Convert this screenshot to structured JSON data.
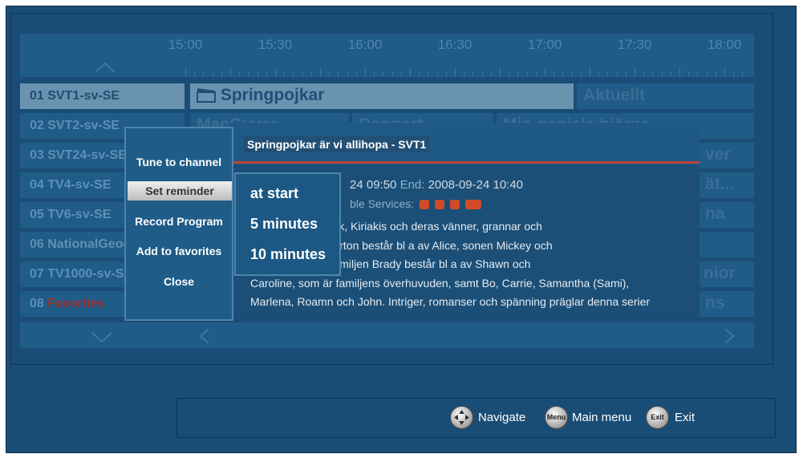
{
  "timeline": {
    "times": [
      "15:00",
      "15:30",
      "16:00",
      "16:30",
      "17:00",
      "17:30",
      "18:00"
    ]
  },
  "channels": [
    {
      "number": "01",
      "name": "SVT1-sv-SE"
    },
    {
      "number": "02",
      "name": "SVT2-sv-SE"
    },
    {
      "number": "03",
      "name": "SVT24-sv-SE"
    },
    {
      "number": "04",
      "name": "TV4-sv-SE"
    },
    {
      "number": "05",
      "name": "TV6-sv-SE"
    },
    {
      "number": "06",
      "name": "NationalGeographic"
    },
    {
      "number": "07",
      "name": "TV1000-sv-SE"
    },
    {
      "number": "08",
      "name": "Favorites"
    }
  ],
  "programs": {
    "ch1": [
      "Springpojkar",
      "Aktuellt"
    ],
    "ch2": [
      "MacGyver",
      "Rapport",
      "Min geniala hjärna"
    ],
    "ch3_right": "ver",
    "ch4_right": "ät...",
    "ch5_right": "na",
    "ch7_right": "nior",
    "ch8_right": "ns"
  },
  "info_popup": {
    "title": "Springpojkar är  vi allihopa - SVT1",
    "start_value": "24 09:50",
    "end_label": "End:",
    "end_value": "2008-09-24 10:40",
    "services_label": "ble Services:",
    "description": [
      "orton, Brady, Black, Kiriakis och deras vänner, grannar och",
      "USA. Familjen Horton består bl a av Alice, sonen Mickey och",
      "nifer och Mike. Familjen Brady består bl a av Shawn och",
      "Caroline, som är familjens överhuvuden, samt Bo, Carrie, Samantha (Sami),",
      "Marlena, Roamn och John. Intriger, romanser och spänning präglar denna serier"
    ]
  },
  "context_menu": {
    "items": [
      "Tune to channel",
      "Set reminder",
      "Record Program",
      "Add to favorites",
      "Close"
    ],
    "selected_index": 1
  },
  "reminder_submenu": {
    "items": [
      "at start",
      "5 minutes",
      "10 minutes"
    ]
  },
  "footer": {
    "navigate_label": "Navigate",
    "menu_icon_text": "Menu",
    "main_menu_label": "Main menu",
    "exit_icon_text": "Exit",
    "exit_label": "Exit"
  },
  "colors": {
    "background": "#1a4d75",
    "selected_row": "#6a93b0",
    "accent_red": "#c1423a"
  }
}
